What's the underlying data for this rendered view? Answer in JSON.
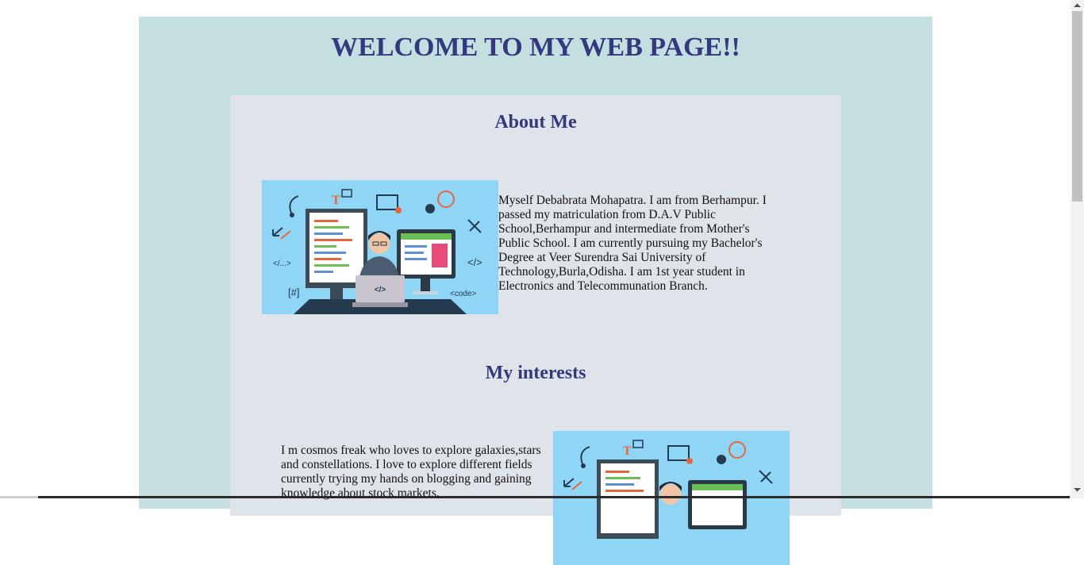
{
  "page": {
    "title": "WELCOME TO MY WEB PAGE!!"
  },
  "about": {
    "heading": "About Me",
    "text": "Myself Debabrata Mohapatra. I am from Berhampur. I passed my matriculation from D.A.V Public School,Berhampur and intermediate from Mother's Public School. I am currently pursuing my Bachelor's Degree at Veer Surendra Sai University of Technology,Burla,Odisha. I am 1st year student in Electronics and Telecommunation Branch.",
    "image_labels": {
      "tl": "</...>",
      "r": "</>",
      "hash": "[#]",
      "code": "<code>",
      "laptop": "</>"
    }
  },
  "interests": {
    "heading": "My interests",
    "text": "I m cosmos freak who loves to explore galaxies,stars and constellations. I love to explore different fields currently trying my hands on blogging and gaining knowledge about stock markets."
  },
  "colors": {
    "outer_bg": "#c3dfdf",
    "card_bg": "#dfe3ea",
    "heading": "#34387e",
    "illustration_sky": "#8fd6f6"
  }
}
